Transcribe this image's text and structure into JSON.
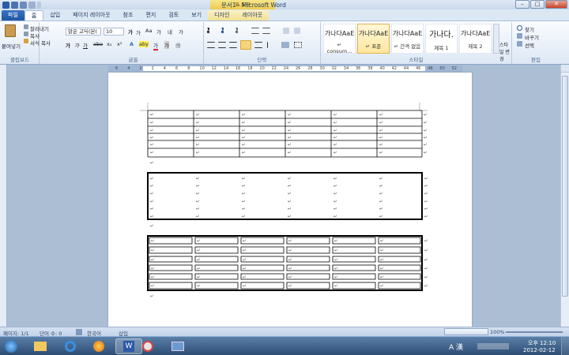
{
  "window": {
    "title": "문서1 - Microsoft Word",
    "context_tab": "표 도구",
    "min": "–",
    "max": "□",
    "close": "✕"
  },
  "tabs": [
    {
      "label": "파일"
    },
    {
      "label": "홈"
    },
    {
      "label": "삽입"
    },
    {
      "label": "페이지 레이아웃"
    },
    {
      "label": "참조"
    },
    {
      "label": "편지"
    },
    {
      "label": "검토"
    },
    {
      "label": "보기"
    },
    {
      "label": "디자인"
    },
    {
      "label": "레이아웃"
    }
  ],
  "clipboard": {
    "paste": "붙여넣기",
    "cut": "잘라내기",
    "copy": "복사",
    "format_painter": "서식 복사",
    "group": "클립보드"
  },
  "font": {
    "name": "맑은 고딕(본(",
    "size": "10",
    "grow": "가",
    "shrink": "가",
    "case": "Aa",
    "clear": "가",
    "phonetic": "내",
    "border_char": "가",
    "bold": "가",
    "italic": "가",
    "underline": "가",
    "strike": "abe",
    "sub": "x₂",
    "sup": "x²",
    "effects": "A",
    "highlight": "aby",
    "color": "가",
    "shade": "가",
    "enclose": "㉮",
    "group": "글꼴"
  },
  "paragraph": {
    "group": "단락"
  },
  "styles": {
    "items": [
      {
        "preview": "가나다AaE",
        "name": "↵ consum..."
      },
      {
        "preview": "가나다AaE",
        "name": "↵ 표준"
      },
      {
        "preview": "가나다AaE",
        "name": "↵ 간격 없음"
      },
      {
        "preview": "가나다.",
        "name": "제목 1"
      },
      {
        "preview": "가나다AaE",
        "name": "제목 2"
      }
    ],
    "change": "스타일 변경",
    "group": "스타일"
  },
  "editing": {
    "find": "찾기",
    "replace": "바꾸기",
    "select": "선택",
    "group": "편집"
  },
  "ruler": {
    "labels": [
      "6",
      "4",
      "2",
      "2",
      "4",
      "6",
      "8",
      "10",
      "12",
      "14",
      "16",
      "18",
      "20",
      "22",
      "24",
      "26",
      "28",
      "30",
      "32",
      "34",
      "36",
      "38",
      "40",
      "42",
      "44",
      "46",
      "48",
      "50",
      "52"
    ]
  },
  "status": {
    "page": "페이지: 1/1",
    "words": "단어 수: 0",
    "lang": "한국어",
    "mode": "삽입",
    "zoom": "100%"
  },
  "taskbar": {
    "ime": "A 漢",
    "time": "오후 12:10",
    "date": "2012-02-12"
  },
  "colors": {
    "accent": "#2b579a",
    "table_border": "#000000"
  }
}
